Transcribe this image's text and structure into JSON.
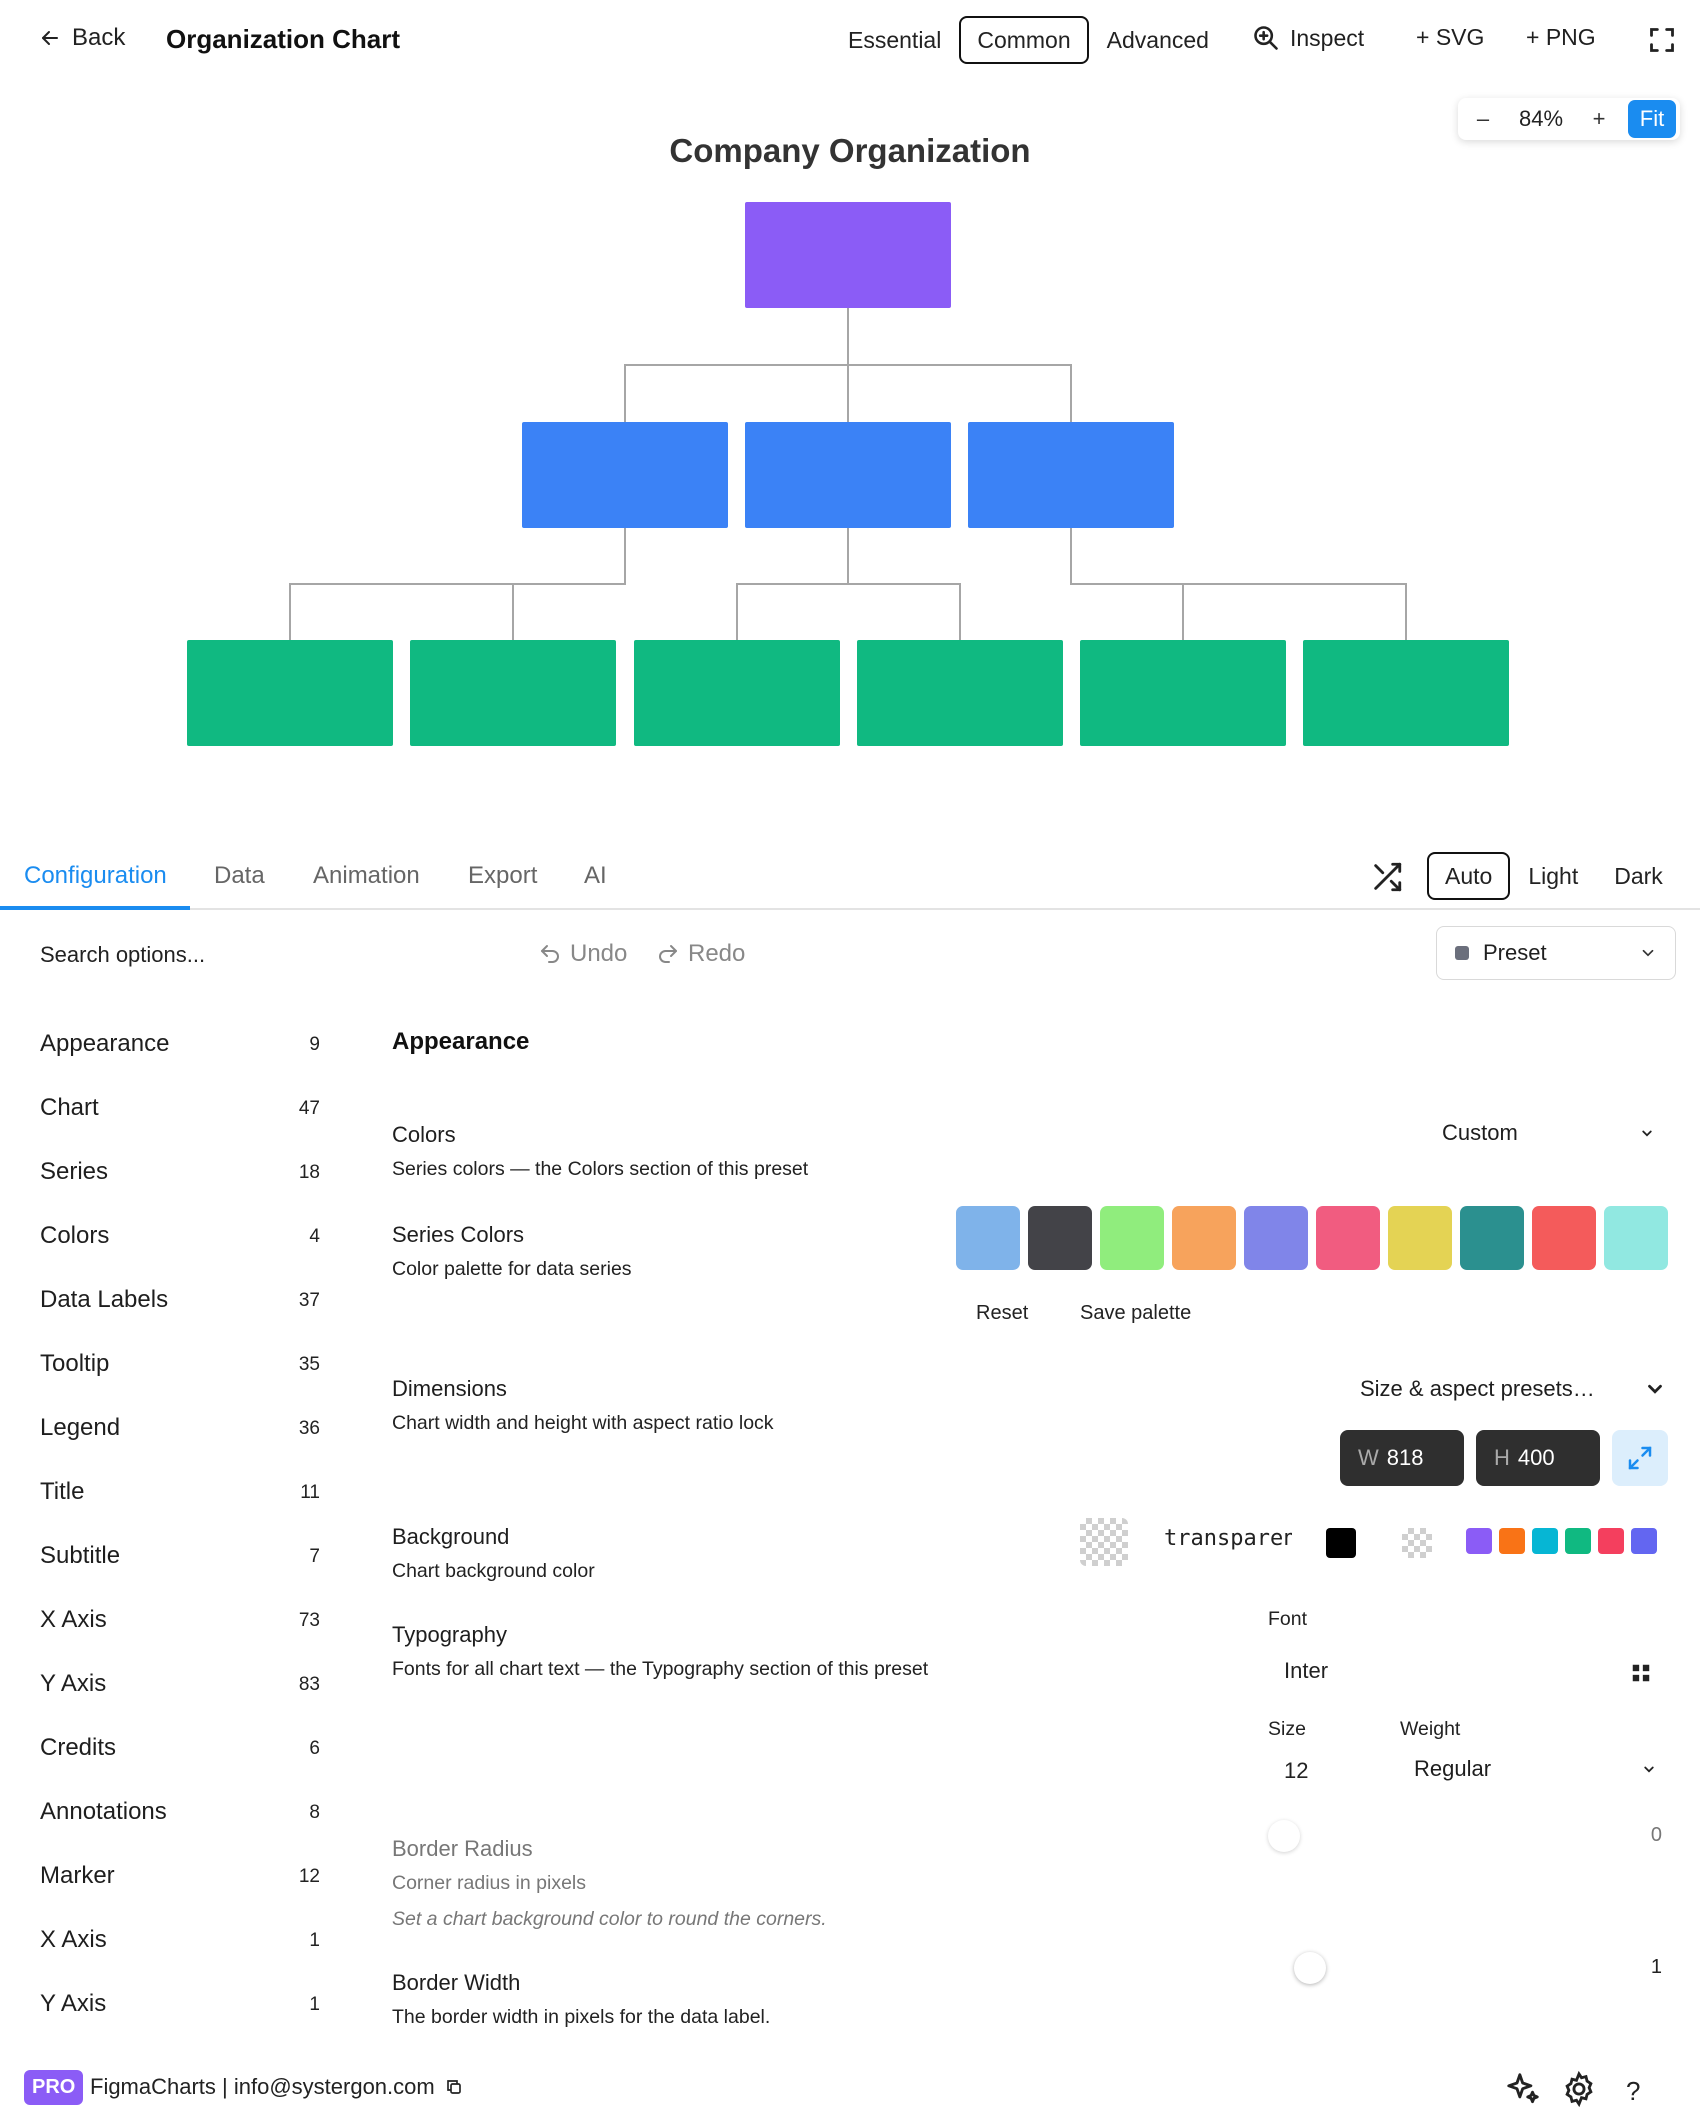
{
  "header": {
    "back_label": "Back",
    "title": "Organization Chart",
    "modes": [
      "Essential",
      "Common",
      "Advanced"
    ],
    "active_mode": "Common",
    "inspect_label": "Inspect",
    "add_svg_label": "+ SVG",
    "add_png_label": "+ PNG"
  },
  "zoom": {
    "minus": "–",
    "value": "84%",
    "plus": "+",
    "fit_label": "Fit"
  },
  "chart_data": {
    "type": "organization",
    "title": "Company Organization",
    "levels": [
      {
        "level": 1,
        "color": "#8b5cf6",
        "nodes": 1
      },
      {
        "level": 2,
        "color": "#3b82f6",
        "nodes": 3
      },
      {
        "level": 3,
        "color": "#10b981",
        "nodes": 6
      }
    ],
    "edges": [
      [
        0,
        1
      ],
      [
        0,
        2
      ],
      [
        0,
        3
      ],
      [
        1,
        4
      ],
      [
        1,
        5
      ],
      [
        2,
        6
      ],
      [
        2,
        7
      ],
      [
        3,
        8
      ],
      [
        3,
        9
      ]
    ],
    "node_labels": []
  },
  "tabs": {
    "items": [
      "Configuration",
      "Data",
      "Animation",
      "Export",
      "AI"
    ],
    "active": "Configuration",
    "themes": [
      "Auto",
      "Light",
      "Dark"
    ],
    "active_theme": "Auto"
  },
  "toolbar": {
    "search_placeholder": "Search options...",
    "undo_label": "Undo",
    "redo_label": "Redo",
    "preset_label": "Preset"
  },
  "sidebar": {
    "items": [
      {
        "label": "Appearance",
        "count": "9"
      },
      {
        "label": "Chart",
        "count": "47"
      },
      {
        "label": "Series",
        "count": "18"
      },
      {
        "label": "Colors",
        "count": "4"
      },
      {
        "label": "Data Labels",
        "count": "37"
      },
      {
        "label": "Tooltip",
        "count": "35"
      },
      {
        "label": "Legend",
        "count": "36"
      },
      {
        "label": "Title",
        "count": "11"
      },
      {
        "label": "Subtitle",
        "count": "7"
      },
      {
        "label": "X Axis",
        "count": "73"
      },
      {
        "label": "Y Axis",
        "count": "83"
      },
      {
        "label": "Credits",
        "count": "6"
      },
      {
        "label": "Annotations",
        "count": "8"
      },
      {
        "label": "Marker",
        "count": "12"
      },
      {
        "label": "X Axis",
        "count": "1"
      },
      {
        "label": "Y Axis",
        "count": "1"
      }
    ]
  },
  "settings": {
    "section_title": "Appearance",
    "colors": {
      "title": "Colors",
      "desc": "Series colors — the Colors section of this preset",
      "value": "Custom"
    },
    "series_colors": {
      "title": "Series Colors",
      "desc": "Color palette for data series",
      "palette": [
        "#7fb3ea",
        "#434348",
        "#90ed7d",
        "#f7a35c",
        "#8085e9",
        "#f15c80",
        "#e4d354",
        "#2b908f",
        "#f45b5b",
        "#91e8e1"
      ],
      "reset_label": "Reset",
      "save_label": "Save palette"
    },
    "dimensions": {
      "title": "Dimensions",
      "desc": "Chart width and height with aspect ratio lock",
      "presets_label": "Size & aspect presets…",
      "width_key": "W",
      "width": "818",
      "height_key": "H",
      "height": "400"
    },
    "background": {
      "title": "Background",
      "desc": "Chart background color",
      "value": "transparent",
      "quick_colors": [
        "#8b5cf6",
        "#f97316",
        "#06b6d4",
        "#10b981",
        "#f43f5e",
        "#6366f1"
      ]
    },
    "typography": {
      "title": "Typography",
      "desc": "Fonts for all chart text — the Typography section of this preset",
      "font_label": "Font",
      "font_value": "Inter",
      "size_label": "Size",
      "size_value": "12",
      "weight_label": "Weight",
      "weight_value": "Regular"
    },
    "border_radius": {
      "title": "Border Radius",
      "desc": "Corner radius in pixels",
      "note": "Set a chart background color to round the corners.",
      "value": "0"
    },
    "border_width": {
      "title": "Border Width",
      "desc": "The border width in pixels for the data label.",
      "value": "1"
    }
  },
  "footer": {
    "badge": "PRO",
    "text": "FigmaCharts | info@systergon.com",
    "help": "?"
  }
}
